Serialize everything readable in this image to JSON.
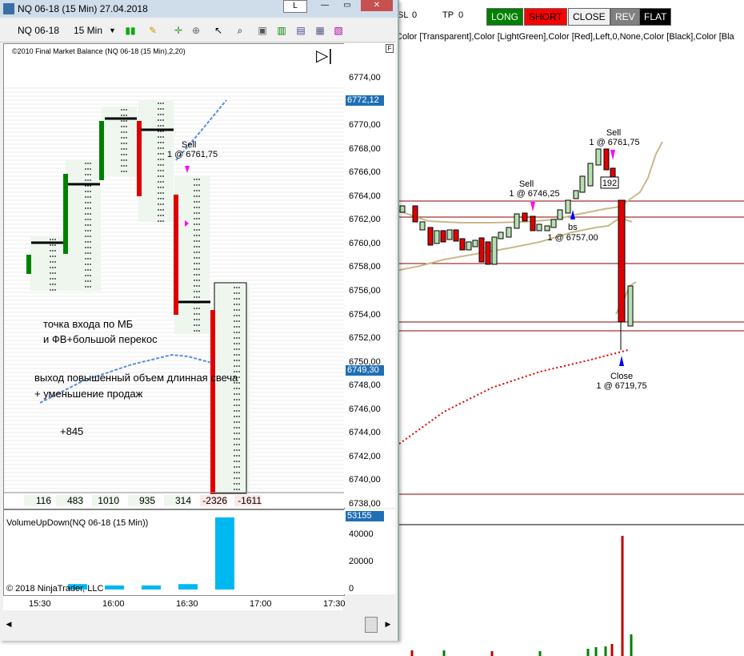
{
  "window": {
    "title": "NQ 06-18 (15 Min)  27.04.2018",
    "button_l": "L",
    "button_min": "—",
    "button_max": "▭",
    "button_close": "✕"
  },
  "toolbar": {
    "instrument": "NQ 06-18",
    "interval": "15 Min",
    "icons": [
      "bars-icon",
      "pencil-icon",
      "crosshair-icon",
      "zoom-icon",
      "select-icon",
      "search-icon",
      "properties-icon",
      "candles-icon",
      "data-box-icon",
      "indicator-icon"
    ]
  },
  "chart": {
    "indicator_label": "©2010 Final Market Balance  (NQ 06-18 (15 Min),2,20)",
    "annotation_1": "точка входа по МБ",
    "annotation_2": "и ФВ+большой перекос",
    "annotation_3": "выход повышенный объем  длинная свеча",
    "annotation_4": "+ уменьшение продаж",
    "annotation_5": "+845",
    "sell_label": "Sell",
    "sell_price": "1 @ 6761,75",
    "delta_values": [
      "116",
      "483",
      "1010",
      "935",
      "314",
      "-2326",
      "-1611"
    ],
    "y_ticks": [
      "6774,00",
      "6772,00",
      "6770,00",
      "6768,00",
      "6766,00",
      "6764,00",
      "6762,00",
      "6760,00",
      "6758,00",
      "6756,00",
      "6754,00",
      "6752,00",
      "6750,00",
      "6748,00",
      "6746,00",
      "6744,00",
      "6742,00",
      "6740,00",
      "6738,00"
    ],
    "price_badge_top": "6772,12",
    "price_badge_bottom": "6749,30",
    "indicator_panel_label": "VolumeUpDown(NQ 06-18 (15 Min))",
    "volume_ticks": [
      "40000",
      "20000",
      "0"
    ],
    "volume_badge": "53155",
    "copyright": "© 2018 NinjaTrader, LLC",
    "x_ticks": [
      "15:30",
      "16:00",
      "16:30",
      "17:00",
      "17:30"
    ],
    "volume_values": [
      0,
      4000,
      3000,
      3000,
      4000,
      53155
    ]
  },
  "background_chart": {
    "sl_label": "SL",
    "sl_value": "0",
    "tp_label": "TP",
    "tp_value": "0",
    "btn_long": "LONG",
    "btn_short": "SHORT",
    "btn_close": "CLOSE",
    "btn_rev": "REV",
    "btn_flat": "FLAT",
    "params": "Color [Transparent],Color [LightGreen],Color [Red],Left,0,None,Color [Black],Color [Bla",
    "sell1_label": "Sell",
    "sell1_price": "1 @ 6746,25",
    "sell2_label": "Sell",
    "sell2_price": "1 @ 6761,75",
    "buy_label": "bs",
    "buy_price": "1 @ 6757,00",
    "close_label": "Close",
    "close_price": "1 @ 6719,75",
    "box_value": "192",
    "colors": {
      "long": "#008000",
      "short": "#ff0000",
      "close": "#f0f0f0",
      "rev": "#808080",
      "flat": "#000000"
    }
  }
}
